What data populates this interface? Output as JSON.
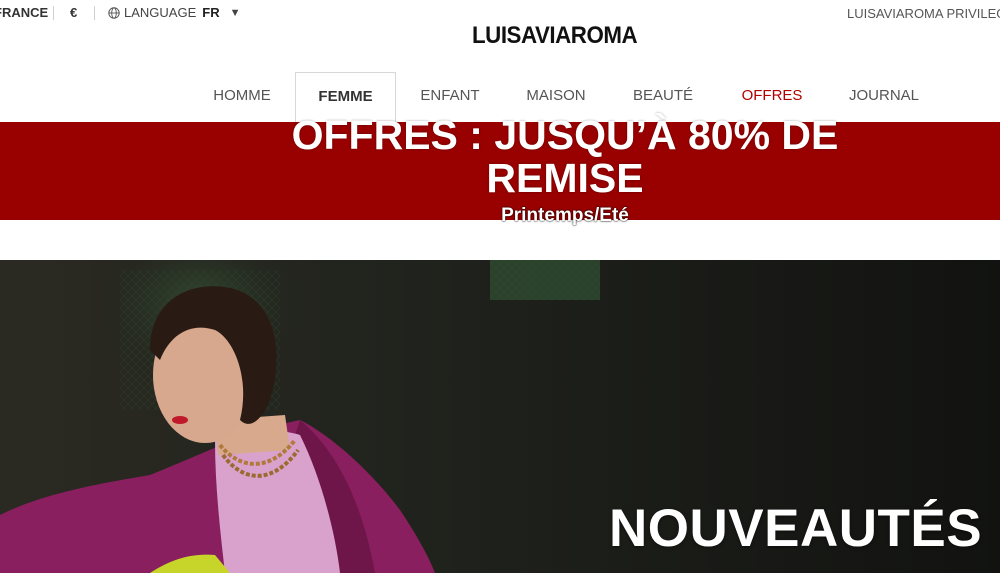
{
  "topbar": {
    "country": "FRANCE",
    "currency": "€",
    "language_label": "LANGUAGE",
    "language_code": "FR",
    "privilege": "LUISAVIAROMA PRIVILEGE"
  },
  "logo": "LUISAVIAROMA",
  "nav": {
    "items": [
      {
        "label": "HOMME"
      },
      {
        "label": "FEMME"
      },
      {
        "label": "ENFANT"
      },
      {
        "label": "MAISON"
      },
      {
        "label": "BEAUTÉ"
      },
      {
        "label": "OFFRES"
      },
      {
        "label": "JOURNAL"
      }
    ]
  },
  "banner": {
    "line1": "OFFRES : JUSQU’À 80% DE",
    "line2": "REMISE",
    "sub": "Printemps/Eté",
    "color": "#990000"
  },
  "hero": {
    "title": "NOUVEAUTÉS"
  }
}
